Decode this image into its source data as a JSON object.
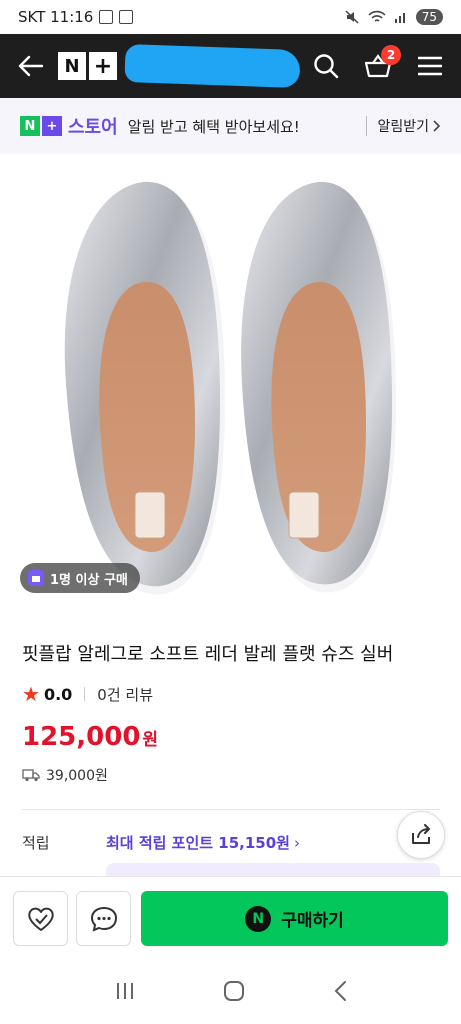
{
  "status_bar": {
    "carrier_time": "SKT 11:16",
    "battery": "75"
  },
  "top_nav": {
    "cart_count": "2"
  },
  "store_banner": {
    "store_name": "스토어",
    "message": "알림 받고 혜택 받아보세요!",
    "alert_label": "알림받기"
  },
  "product": {
    "buyers_badge": "1명 이상 구매",
    "title": "핏플랍 알레그로 소프트 레더 발레 플랫 슈즈 실버",
    "rating": "0.0",
    "review_count": "0건 리뷰",
    "price": "125,000",
    "price_unit": "원",
    "shipping_fee": "39,000원"
  },
  "points": {
    "label": "적립",
    "value": "최대 적립 포인트 15,150원"
  },
  "action_bar": {
    "buy_label": "구매하기"
  },
  "colors": {
    "nav_bg": "#1e1e1e",
    "accent_purple": "#6a4ae8",
    "price_red": "#e3122c",
    "buy_green": "#03c75a",
    "star_red": "#f2361f"
  }
}
